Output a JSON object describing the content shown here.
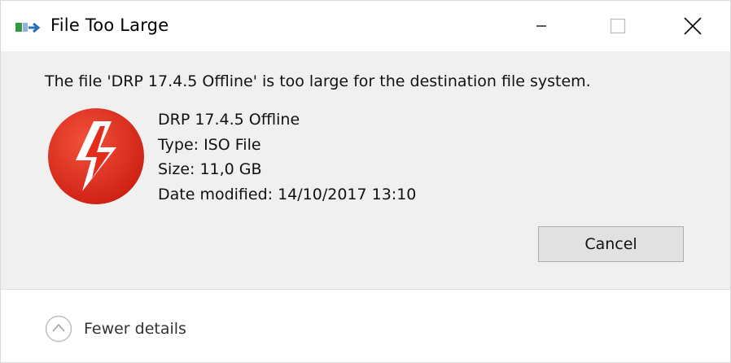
{
  "window": {
    "title": "File Too Large"
  },
  "dialog": {
    "message": "The file 'DRP 17.4.5 Offline' is too large for the destination file system.",
    "file": {
      "name": "DRP 17.4.5 Offline",
      "type_line": "Type: ISO File",
      "size_line": "Size: 11,0 GB",
      "date_line": "Date modified: 14/10/2017 13:10"
    },
    "cancel_label": "Cancel",
    "details_label": "Fewer details"
  },
  "icons": {
    "title": "file-transfer-icon",
    "file": "daemon-tools-lightning-icon",
    "minimize": "minimize-icon",
    "maximize": "maximize-icon",
    "close": "close-icon",
    "details": "chevron-up-circle-icon"
  },
  "colors": {
    "content_bg": "#f0f0f0",
    "button_bg": "#e1e1e1",
    "button_border": "#adadad",
    "icon_red": "#e42c1b"
  }
}
